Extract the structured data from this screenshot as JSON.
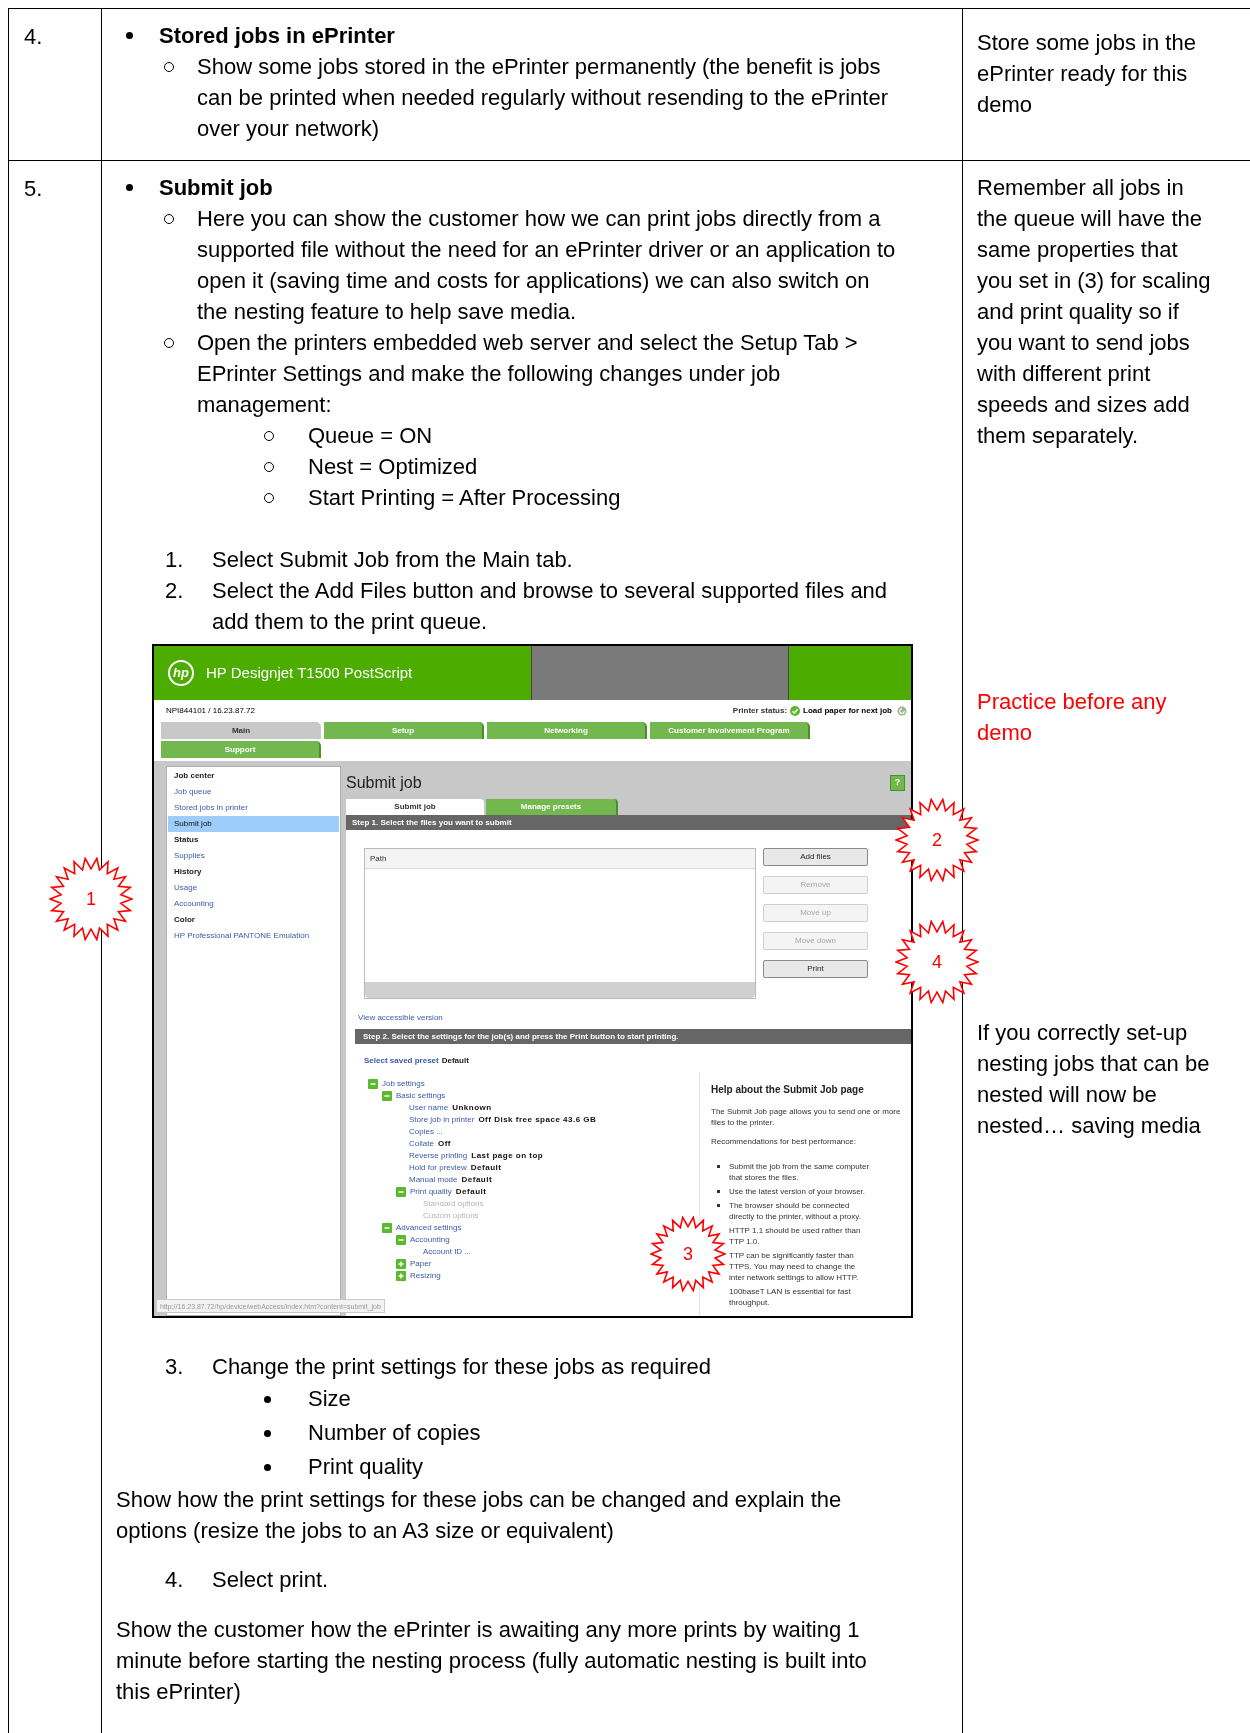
{
  "rows": [
    {
      "number": "4.",
      "blocks": [
        {
          "kind": "heading",
          "text": "Stored jobs in ePrinter"
        },
        {
          "kind": "sub",
          "text": "Show some jobs stored in the ePrinter permanently (the benefit is jobs can be printed when needed regularly without resending to the ePrinter over your network)"
        }
      ],
      "notes": [
        {
          "text": "Store some jobs in the ePrinter ready for this demo",
          "color": "#000000"
        }
      ]
    },
    {
      "number": "5.",
      "blocks": [
        {
          "kind": "heading",
          "text": "Submit job"
        },
        {
          "kind": "sub",
          "text": "Here you can show the customer how we can print jobs directly from a supported file without the need for an ePrinter driver or an application to open it (saving time and costs for applications) we can also switch on the nesting feature to help save media."
        },
        {
          "kind": "sub",
          "text": "Open the printers embedded web server and select the Setup Tab > EPrinter Settings and make the following changes under job management:"
        },
        {
          "kind": "subsub",
          "text": "Queue = ON"
        },
        {
          "kind": "subsub",
          "text": "Nest = Optimized"
        },
        {
          "kind": "subsub",
          "text": "Start Printing = After Processing"
        },
        {
          "kind": "numbered",
          "number": "1.",
          "text": "Select Submit Job from the Main tab."
        },
        {
          "kind": "numbered",
          "number": "2.",
          "text": "Select the Add Files button and browse to several supported files and add them to the print queue."
        },
        {
          "kind": "screenshot"
        },
        {
          "kind": "numbered",
          "number": "3.",
          "text": "Change the print settings for these jobs as required"
        },
        {
          "kind": "dot",
          "text": "Size"
        },
        {
          "kind": "dot",
          "text": "Number of copies"
        },
        {
          "kind": "dot",
          "text": "Print quality"
        },
        {
          "kind": "paragraph",
          "text": "Show how the print settings for these jobs can be changed and explain the options (resize the jobs to an A3 size or equivalent)"
        },
        {
          "kind": "numbered",
          "number": "4.",
          "text": "Select print."
        },
        {
          "kind": "paragraph",
          "text": "Show the customer how the ePrinter is awaiting any more prints by waiting 1 minute before starting the nesting process (fully automatic nesting is built into this ePrinter)"
        }
      ],
      "notes": [
        {
          "text": "Remember all jobs in the queue will have the same properties that you set in (3) for scaling and print quality so if you want to send jobs with different print speeds and sizes add them separately.",
          "color": "#000000"
        },
        {
          "text": "Practice before any demo",
          "color": "#ff0000"
        },
        {
          "text": "If you correctly set-up nesting jobs that can be nested will now be nested… saving media",
          "color": "#000000"
        }
      ]
    }
  ],
  "screenshot": {
    "logo": "hp",
    "title": "HP Designjet T1500 PostScript",
    "device": "NPI844101 / 16.23.87.72",
    "status_label": "Printer status:",
    "status": "Load paper for next job",
    "tabs": [
      {
        "label": "Main",
        "selected": true
      },
      {
        "label": "Setup",
        "selected": false
      },
      {
        "label": "Networking",
        "selected": false
      },
      {
        "label": "Customer Involvement Program",
        "selected": false
      },
      {
        "label": "Support",
        "selected": false
      }
    ],
    "sidebar": [
      {
        "label": "Job center",
        "kind": "heading",
        "selected": false
      },
      {
        "label": "Job queue",
        "kind": "link",
        "selected": false
      },
      {
        "label": "Stored jobs in printer",
        "kind": "link",
        "selected": false
      },
      {
        "label": "Submit job",
        "kind": "link",
        "selected": true
      },
      {
        "label": "Status",
        "kind": "heading",
        "selected": false
      },
      {
        "label": "Supplies",
        "kind": "link",
        "selected": false
      },
      {
        "label": "History",
        "kind": "heading",
        "selected": false
      },
      {
        "label": "Usage",
        "kind": "link",
        "selected": false
      },
      {
        "label": "Accounting",
        "kind": "link",
        "selected": false
      },
      {
        "label": "Color",
        "kind": "heading",
        "selected": false
      },
      {
        "label": "HP Professional PANTONE Emulation",
        "kind": "link",
        "selected": false
      }
    ],
    "page_title": "Submit job",
    "help_button": "?",
    "subtabs": [
      {
        "label": "Submit job",
        "selected": true
      },
      {
        "label": "Manage presets",
        "selected": false
      }
    ],
    "step1": "Step 1. Select the files you want to submit",
    "file_list": {
      "column": "Path"
    },
    "buttons": [
      {
        "label": "Add files",
        "disabled": false
      },
      {
        "label": "Remove",
        "disabled": true
      },
      {
        "label": "Move up",
        "disabled": true
      },
      {
        "label": "Move down",
        "disabled": true
      },
      {
        "label": "Print",
        "disabled": false
      }
    ],
    "accessible_link": "View accessible version",
    "step2": "Step 2. Select the settings for the job(s) and press the Print button to start printing.",
    "preset": {
      "label": "Select saved preset",
      "value": "Default"
    },
    "settings": [
      {
        "label": "Job settings",
        "expanded": true,
        "children": [
          {
            "label": "Basic settings",
            "expanded": true,
            "children": [
              {
                "label": "User name",
                "value": "Unknown"
              },
              {
                "label": "Store job in printer",
                "value": "Off Disk free space 43.6 GB"
              },
              {
                "label": "Copies ..."
              },
              {
                "label": "Collate",
                "value": "Off"
              },
              {
                "label": "Reverse printing",
                "value": "Last page on top"
              },
              {
                "label": "Hold for preview",
                "value": "Default"
              },
              {
                "label": "Manual mode",
                "value": "Default"
              },
              {
                "label": "Print quality",
                "value": "Default",
                "expanded": true,
                "children": [
                  {
                    "label": "Standard options",
                    "disabled": true
                  },
                  {
                    "label": "Custom options",
                    "disabled": true
                  }
                ]
              }
            ]
          },
          {
            "label": "Advanced settings",
            "expanded": true,
            "children": [
              {
                "label": "Accounting",
                "expanded": true,
                "children": [
                  {
                    "label": "Account ID ..."
                  }
                ]
              },
              {
                "label": "Paper",
                "expanded": false
              },
              {
                "label": "Resizing",
                "expanded": false
              }
            ]
          }
        ]
      }
    ],
    "help": {
      "title": "Help about the Submit Job page",
      "paragraphs": [
        "The Submit Job page allows you to send one or more files to the printer.",
        "Recommendations for best performance:"
      ],
      "bullets": [
        {
          "lines": [
            "Submit the job from the same computer",
            "that stores the files."
          ],
          "bullet": true
        },
        {
          "lines": [
            "Use the latest version of your browser."
          ],
          "bullet": true
        },
        {
          "lines": [
            "The browser should be connected",
            "directly to the printer, without a proxy."
          ],
          "bullet": true
        },
        {
          "lines": [
            "HTTP 1.1 should be used rather than",
            "TTP 1.0."
          ],
          "bullet": false
        },
        {
          "lines": [
            "TTP can be significantly faster than",
            "TTPS. You may need to change the",
            "inter network settings to allow HTTP."
          ],
          "bullet": false
        },
        {
          "lines": [
            "100baseT LAN is essential for fast",
            "throughput."
          ],
          "bullet": false
        }
      ]
    },
    "url_tooltip": "http://16.23.87.72/hp/device/webAccess/index.htm?content=submit_job"
  },
  "callouts": [
    {
      "label": "1"
    },
    {
      "label": "2"
    },
    {
      "label": "3"
    },
    {
      "label": "4"
    }
  ]
}
